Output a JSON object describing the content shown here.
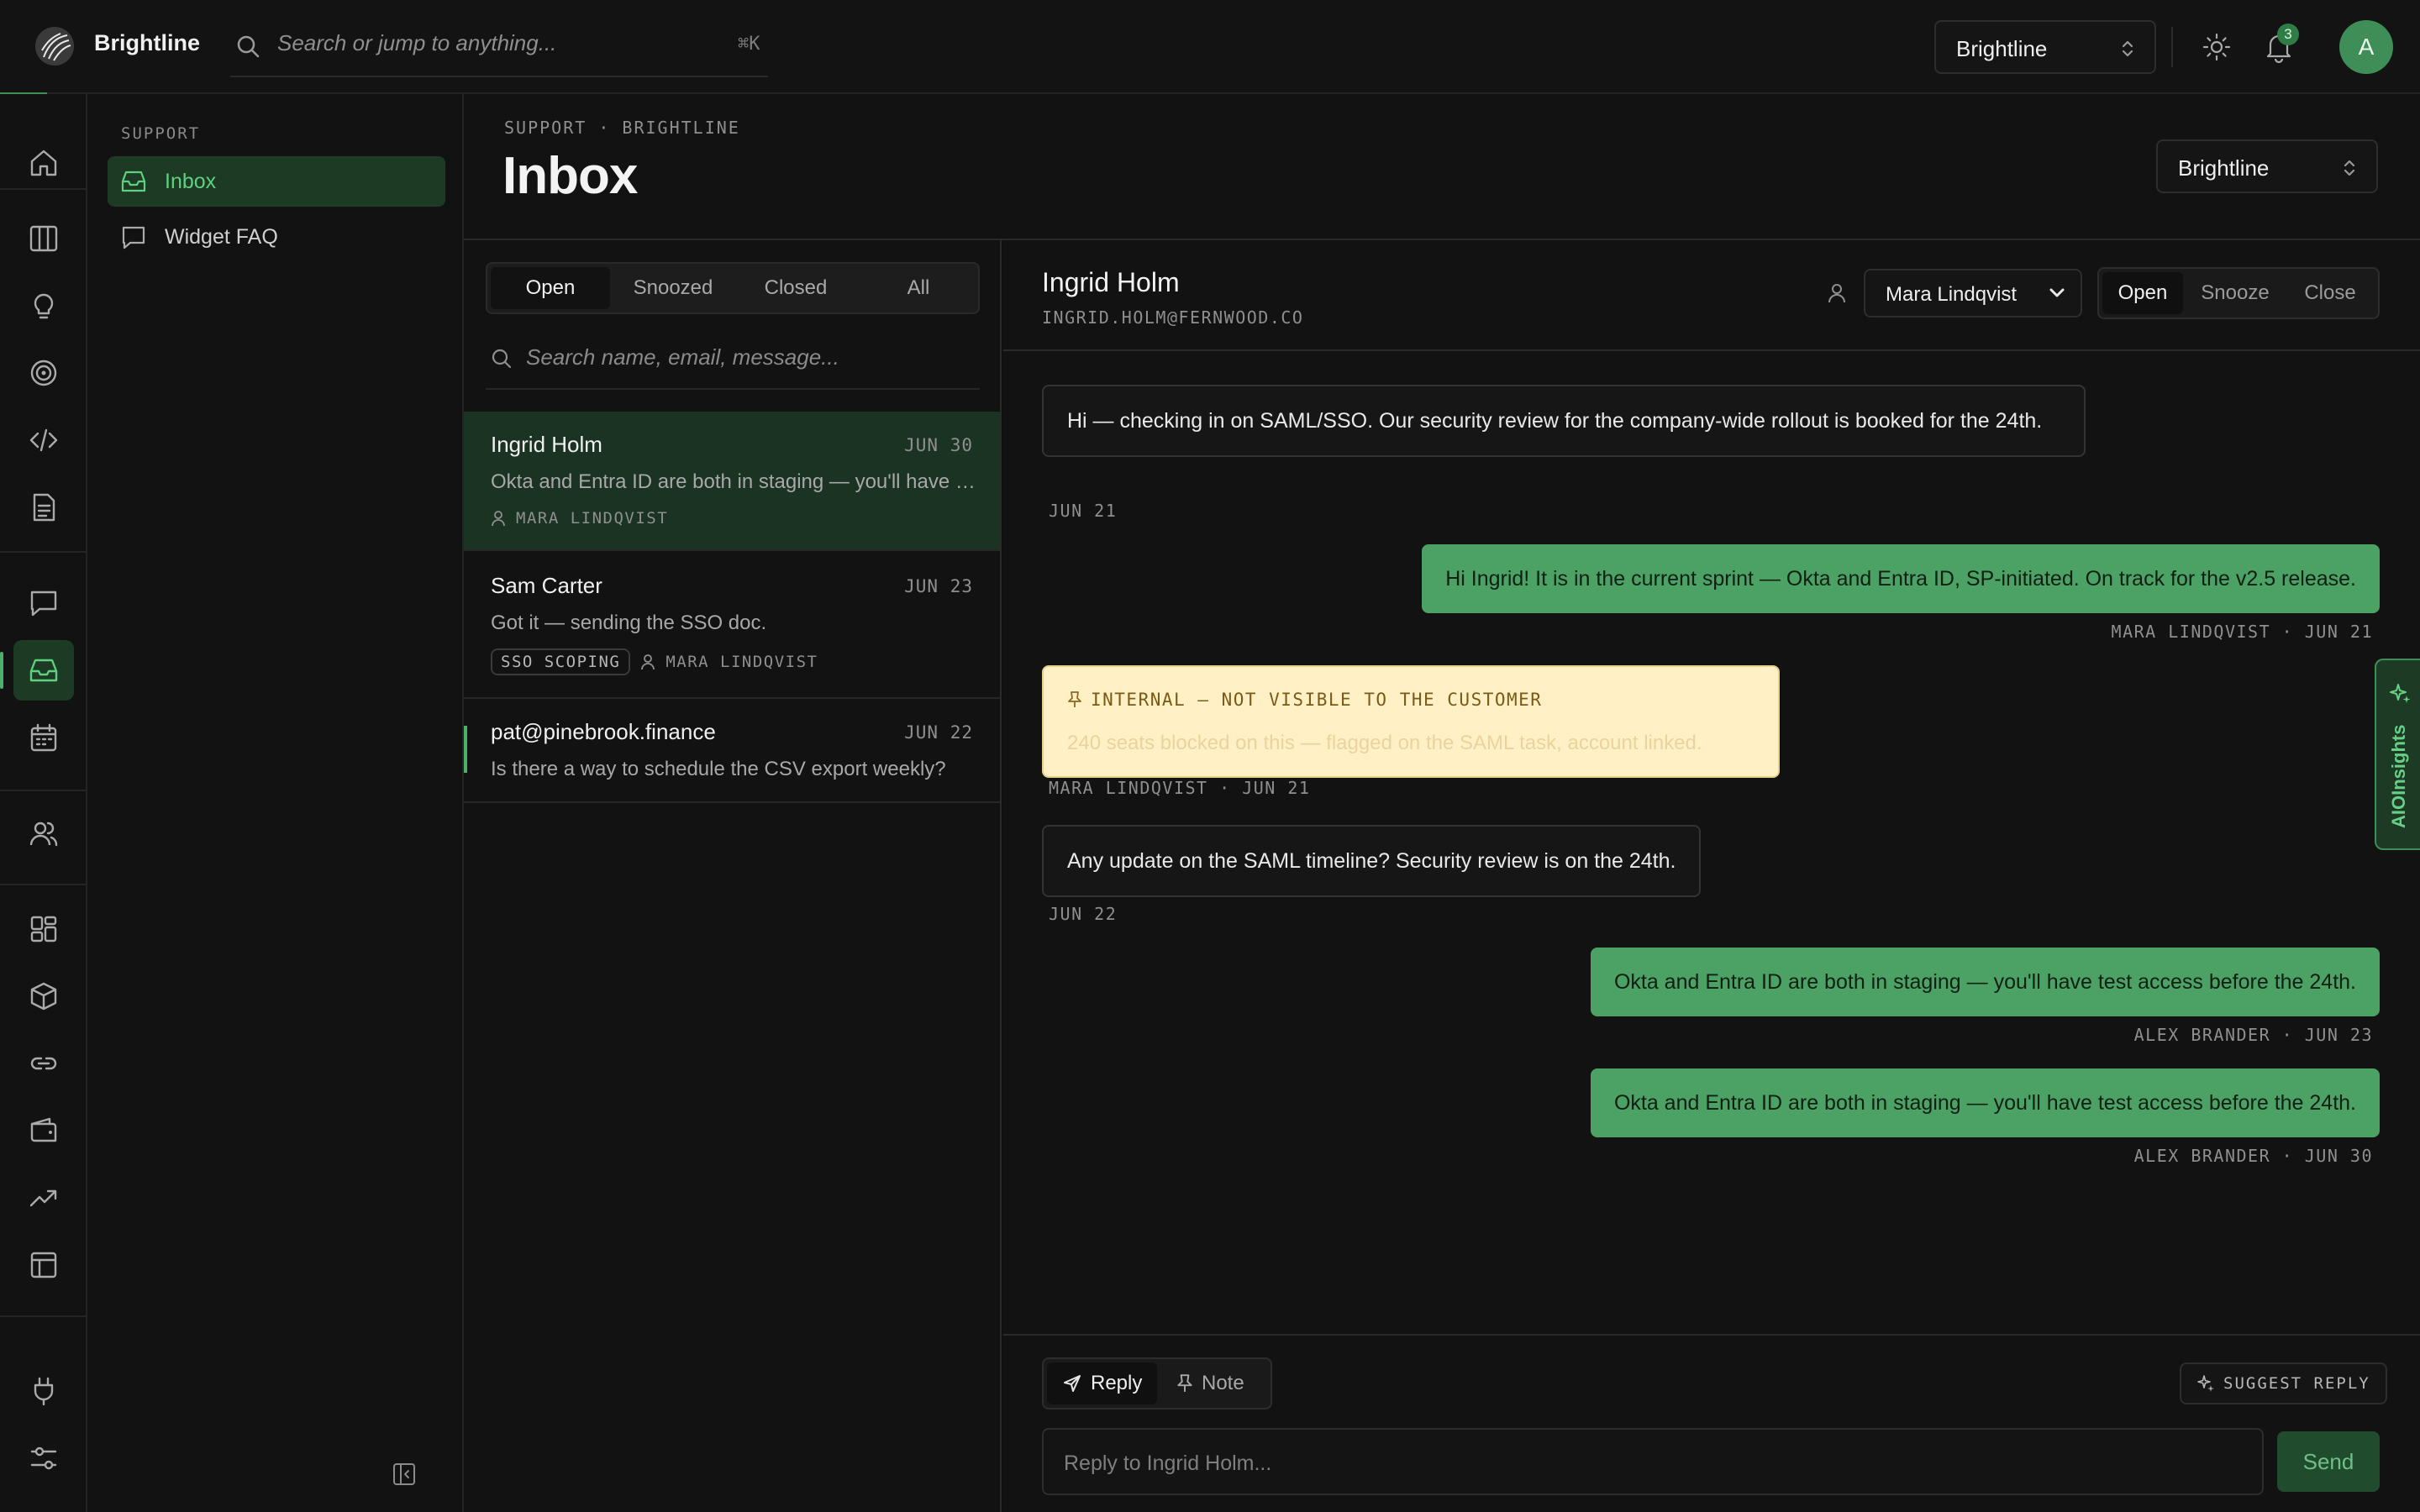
{
  "app": {
    "name": "Brightline"
  },
  "topbar": {
    "search_placeholder": "Search or jump to anything...",
    "shortcut": "⌘K",
    "workspace": "Brightline",
    "notifications_count": "3",
    "avatar_initial": "A"
  },
  "rail": {
    "items": [
      "home-icon",
      "columns-icon",
      "lightbulb-icon",
      "target-icon",
      "code-icon",
      "document-icon",
      "chat-icon",
      "inbox-icon",
      "calendar-icon",
      "users-icon",
      "dashboard-icon",
      "cube-icon",
      "link-icon",
      "wallet-icon",
      "trend-icon",
      "table-icon",
      "plug-icon",
      "sliders-icon"
    ],
    "active": "inbox-icon"
  },
  "sidebar": {
    "section": "SUPPORT",
    "items": [
      {
        "label": "Inbox",
        "icon": "inbox-icon",
        "active": true
      },
      {
        "label": "Widget FAQ",
        "icon": "chat-icon",
        "active": false
      }
    ]
  },
  "header": {
    "breadcrumb": "SUPPORT · BRIGHTLINE",
    "title": "Inbox",
    "workspace": "Brightline"
  },
  "list": {
    "filters": [
      "Open",
      "Snoozed",
      "Closed",
      "All"
    ],
    "active_filter": "Open",
    "search_placeholder": "Search name, email, message...",
    "conversations": [
      {
        "name": "Ingrid Holm",
        "date": "JUN 30",
        "preview": "Okta and Entra ID are both in staging — you'll have test access before the 24th.",
        "tag": "",
        "assignee": "MARA LINDQVIST"
      },
      {
        "name": "Sam Carter",
        "date": "JUN 23",
        "preview": "Got it — sending the SSO doc.",
        "tag": "SSO SCOPING",
        "assignee": "MARA LINDQVIST"
      },
      {
        "name": "pat@pinebrook.finance",
        "date": "JUN 22",
        "preview": "Is there a way to schedule the CSV export weekly?",
        "tag": "",
        "assignee": ""
      }
    ]
  },
  "detail": {
    "name": "Ingrid Holm",
    "email": "INGRID.HOLM@FERNWOOD.CO",
    "assignee": "Mara Lindqvist",
    "status_options": [
      "Open",
      "Snooze",
      "Close"
    ],
    "status_active": "Open",
    "messages": [
      {
        "kind": "in",
        "text": "Hi — checking in on SAML/SSO. Our security review for the company-wide rollout is booked for the 24th.",
        "meta": "JUN 21"
      },
      {
        "kind": "out",
        "text": "Hi Ingrid! It is in the current sprint — Okta and Entra ID, SP-initiated. On track for the v2.5 release.",
        "meta": "MARA LINDQVIST · JUN 21"
      },
      {
        "kind": "note",
        "title": "INTERNAL — NOT VISIBLE TO THE CUSTOMER",
        "text": "240 seats blocked on this — flagged on the SAML task, account linked.",
        "meta": "MARA LINDQVIST · JUN 21"
      },
      {
        "kind": "in",
        "text": "Any update on the SAML timeline? Security review is on the 24th.",
        "meta": "JUN 22"
      },
      {
        "kind": "out",
        "text": "Okta and Entra ID are both in staging — you'll have test access before the 24th.",
        "meta": "ALEX BRANDER · JUN 23"
      },
      {
        "kind": "out",
        "text": "Okta and Entra ID are both in staging — you'll have test access before the 24th.",
        "meta": "ALEX BRANDER · JUN 30"
      }
    ]
  },
  "ai_tab": {
    "label": "AIOInsights"
  },
  "composer": {
    "modes": [
      "Reply",
      "Note"
    ],
    "active_mode": "Reply",
    "suggest_label": "SUGGEST REPLY",
    "placeholder": "Reply to Ingrid Holm...",
    "send_label": "Send"
  },
  "colors": {
    "accent": "#4ca264",
    "active_bg": "#1c3a24",
    "note_bg": "#fff0c6",
    "background": "#121212"
  }
}
